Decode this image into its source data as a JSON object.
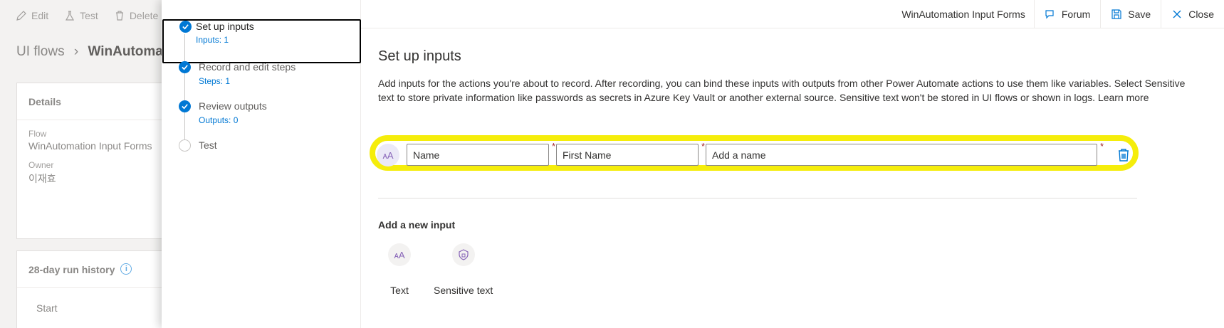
{
  "background": {
    "toolbar": {
      "edit": "Edit",
      "test": "Test",
      "delete": "Delete"
    },
    "breadcrumb": {
      "root": "UI flows",
      "current": "WinAutomatio"
    },
    "details": {
      "title": "Details",
      "flow_label": "Flow",
      "flow_value": "WinAutomation Input Forms",
      "owner_label": "Owner",
      "owner_value": "이재효"
    },
    "history": {
      "title": "28-day run history",
      "start": "Start"
    }
  },
  "steps": [
    {
      "title": "Set up inputs",
      "sub": "Inputs: 1",
      "state": "done"
    },
    {
      "title": "Record and edit steps",
      "sub": "Steps: 1",
      "state": "done"
    },
    {
      "title": "Review outputs",
      "sub": "Outputs: 0",
      "state": "done"
    },
    {
      "title": "Test",
      "sub": "",
      "state": "pending"
    }
  ],
  "topbar": {
    "title": "WinAutomation Input Forms",
    "forum": "Forum",
    "save": "Save",
    "close": "Close"
  },
  "main": {
    "heading": "Set up inputs",
    "description": "Add inputs for the actions you're about to record. After recording, you can bind these inputs with outputs from other Power Automate actions to use them like variables. Select Sensitive text to store private information like passwords as secrets in Azure Key Vault or another external source. Sensitive text won't be stored in UI flows or shown in logs.",
    "learn_more": "Learn more",
    "input_row": {
      "name_value": "Name",
      "label_value": "First Name",
      "description_placeholder": "Add a name"
    },
    "add_new": {
      "title": "Add a new input",
      "text_label": "Text",
      "sensitive_label": "Sensitive text"
    }
  },
  "colors": {
    "accent": "#0078d4",
    "highlight": "#f5ed0b",
    "required": "#a4262c"
  }
}
